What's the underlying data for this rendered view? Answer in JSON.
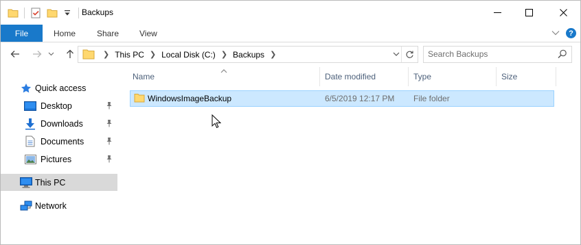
{
  "window": {
    "title": "Backups",
    "controls": {
      "minimize_icon": "minimize-icon",
      "maximize_icon": "maximize-icon",
      "close_icon": "close-icon"
    }
  },
  "quick_access_toolbar": {
    "icons": [
      "folder-icon",
      "properties-icon",
      "new-folder-icon",
      "customize-dropdown-icon"
    ]
  },
  "ribbon": {
    "file_label": "File",
    "tabs": [
      {
        "label": "Home"
      },
      {
        "label": "Share"
      },
      {
        "label": "View"
      }
    ],
    "help_label": "?"
  },
  "navigation": {
    "back_icon": "back-arrow-icon",
    "forward_icon": "forward-arrow-icon",
    "recent_icon": "recent-dropdown-icon",
    "up_icon": "up-arrow-icon"
  },
  "address_bar": {
    "crumbs": [
      "This PC",
      "Local Disk (C:)",
      "Backups"
    ]
  },
  "search": {
    "placeholder": "Search Backups"
  },
  "sidebar": {
    "quick_access": {
      "label": "Quick access"
    },
    "pinned": [
      {
        "label": "Desktop",
        "icon": "desktop-icon"
      },
      {
        "label": "Downloads",
        "icon": "downloads-icon"
      },
      {
        "label": "Documents",
        "icon": "documents-icon"
      },
      {
        "label": "Pictures",
        "icon": "pictures-icon"
      }
    ],
    "this_pc": {
      "label": "This PC",
      "selected": true
    },
    "network": {
      "label": "Network"
    }
  },
  "file_list": {
    "columns": [
      "Name",
      "Date modified",
      "Type",
      "Size"
    ],
    "sorted_by": "Name",
    "rows": [
      {
        "name": "WindowsImageBackup",
        "date_modified": "6/5/2019 12:17 PM",
        "type": "File folder",
        "size": "",
        "selected": true
      }
    ]
  },
  "colors": {
    "accent": "#1979ca",
    "selection_fill": "#cce8ff",
    "selection_border": "#99d1ff",
    "sidebar_selected": "#d9d9d9",
    "folder": "#ffd86f"
  }
}
